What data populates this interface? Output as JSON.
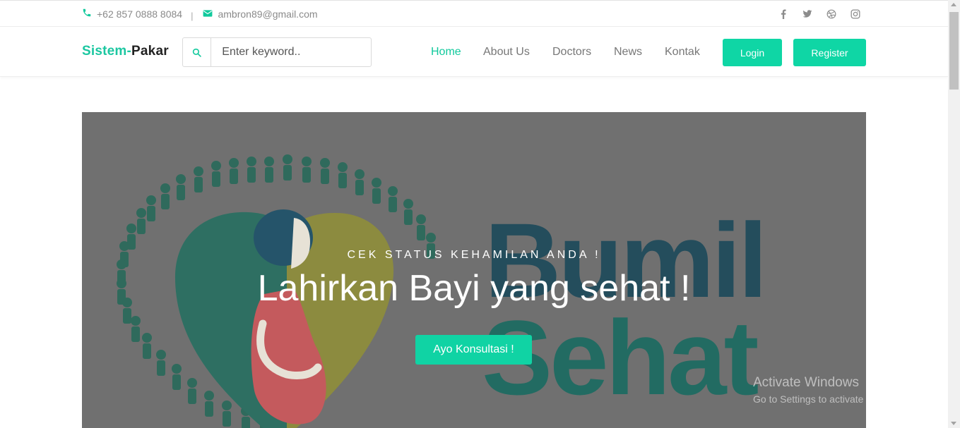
{
  "topbar": {
    "phone": "+62 857 0888 8084",
    "separator": "|",
    "email": "ambron89@gmail.com",
    "social_icons": [
      "facebook-icon",
      "twitter-icon",
      "dribbble-icon",
      "instagram-icon"
    ]
  },
  "navbar": {
    "brand_part1": "Sistem-",
    "brand_part2": "Pakar",
    "search_placeholder": "Enter keyword..",
    "menu": [
      "Home",
      "About Us",
      "Doctors",
      "News",
      "Kontak"
    ],
    "active_menu": "Home",
    "login_label": "Login",
    "register_label": "Register"
  },
  "hero": {
    "kicker": "CEK STATUS KEHAMILAN ANDA !",
    "headline": "Lahirkan Bayi yang sehat !",
    "cta_label": "Ayo Konsultasi !",
    "logo_word1": "Bumil",
    "logo_word2": "Sehat"
  },
  "watermark": {
    "line1": "Activate Windows",
    "line2": "Go to Settings to activate Windows."
  },
  "colors": {
    "accent": "#10d3a4",
    "hero_overlay": "#707070",
    "logo_dark": "#244d5c",
    "logo_teal": "#226b62"
  }
}
